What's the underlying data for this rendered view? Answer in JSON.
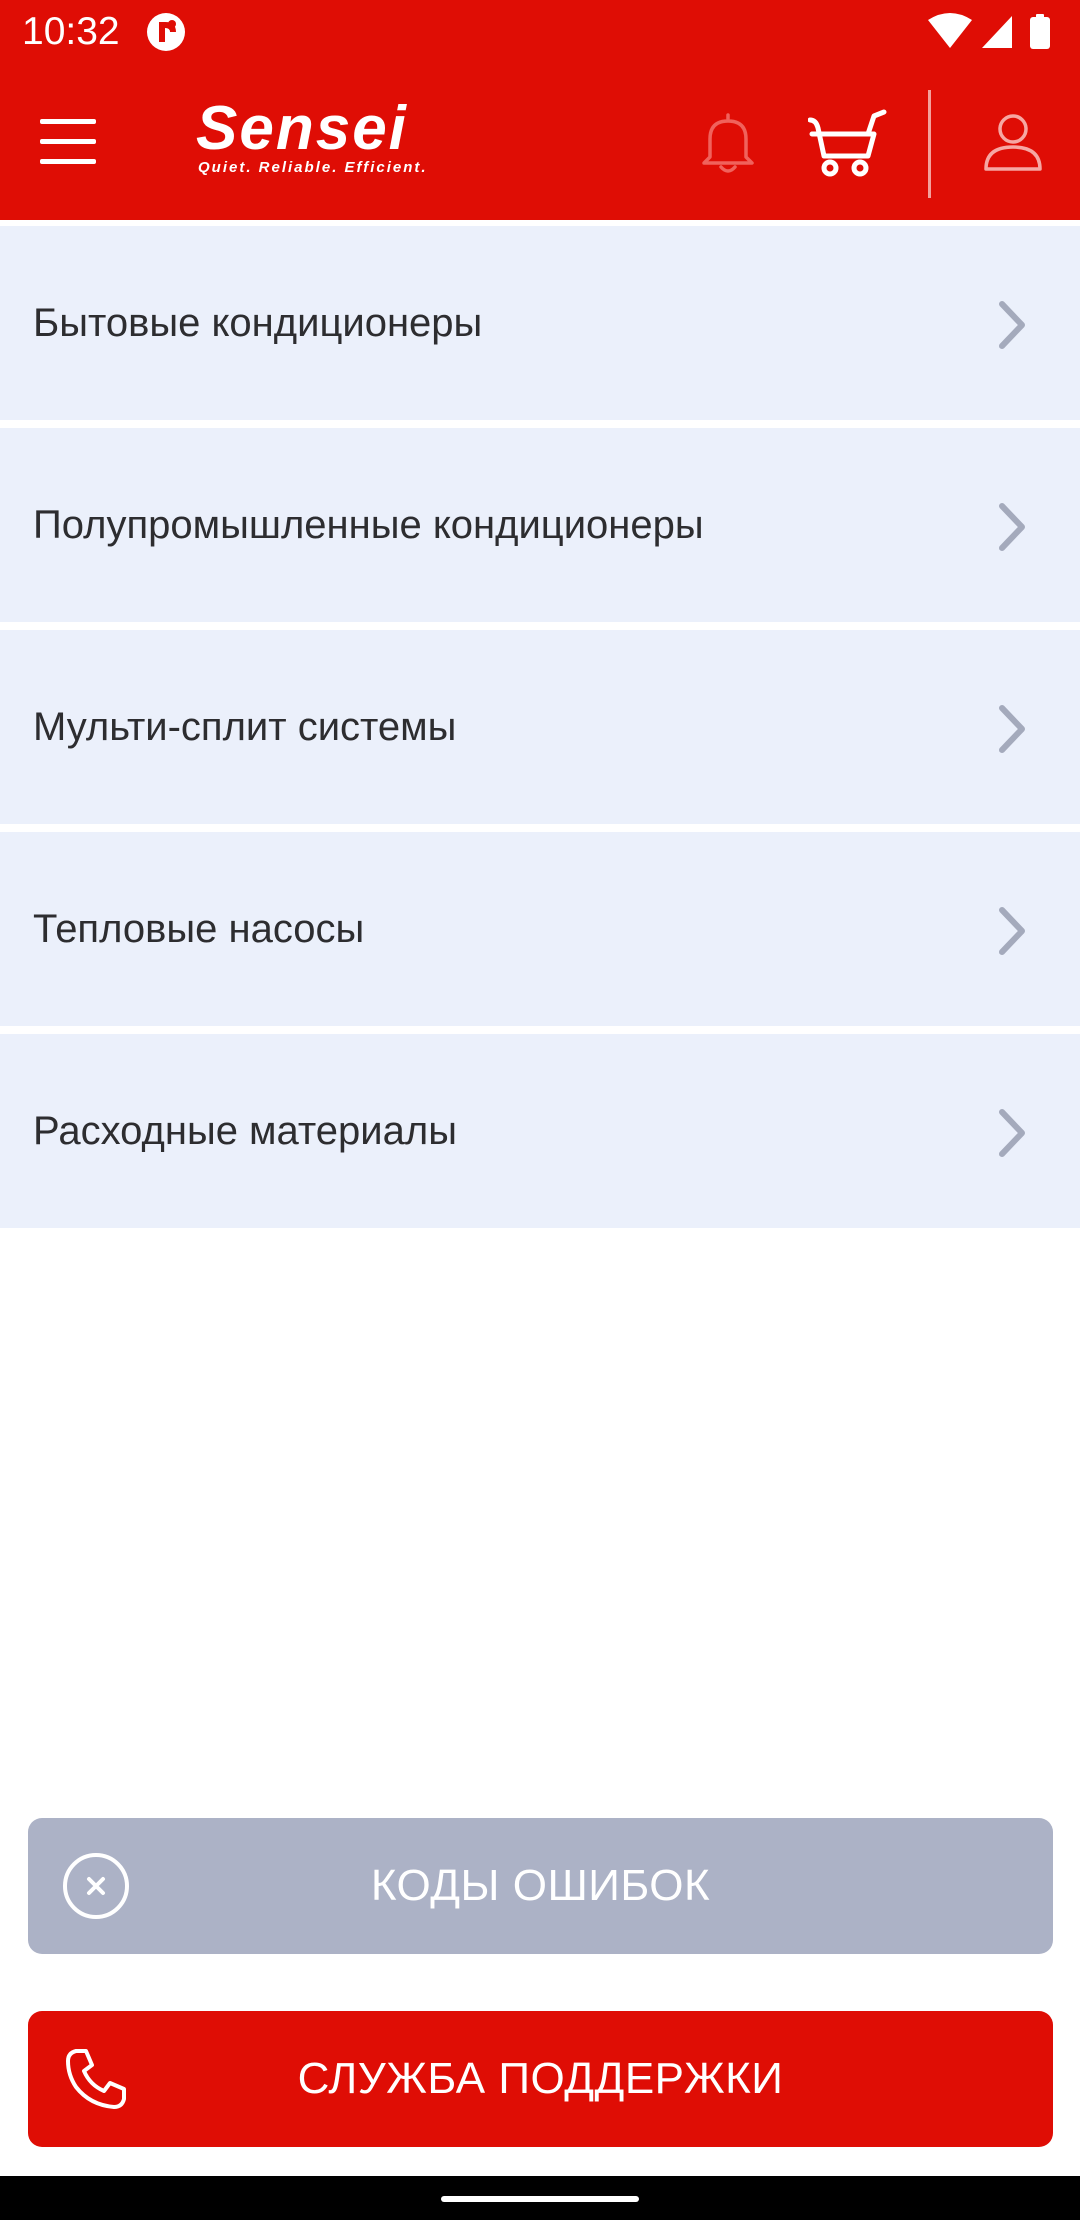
{
  "status_bar": {
    "time": "10:32",
    "icons": [
      "app-notification-icon",
      "wifi-icon",
      "cellular-signal-icon",
      "battery-icon"
    ]
  },
  "app_bar": {
    "brand_name": "Sensei",
    "brand_tagline": "Quiet. Reliable. Efficient.",
    "icons": [
      "menu-icon",
      "bell-icon",
      "cart-icon",
      "user-icon"
    ]
  },
  "categories": [
    {
      "label": "Бытовые кондиционеры",
      "icon": "chevron-right-icon"
    },
    {
      "label": "Полупромышленные кондиционеры",
      "icon": "chevron-right-icon"
    },
    {
      "label": "Мульти-сплит системы",
      "icon": "chevron-right-icon"
    },
    {
      "label": "Тепловые насосы",
      "icon": "chevron-right-icon"
    },
    {
      "label": "Расходные материалы",
      "icon": "chevron-right-icon"
    }
  ],
  "actions": {
    "error_codes": {
      "label": "КОДЫ ОШИБОК",
      "icon": "close-circle-icon"
    },
    "support": {
      "label": "СЛУЖБА ПОДДЕРЖКИ",
      "icon": "phone-icon"
    }
  },
  "colors": {
    "brand_red": "#df0d05",
    "category_bg": "#ebf0fb",
    "disabled_button": "#acb2c6",
    "chevron": "#a4aabc",
    "text": "#2d2d30"
  }
}
